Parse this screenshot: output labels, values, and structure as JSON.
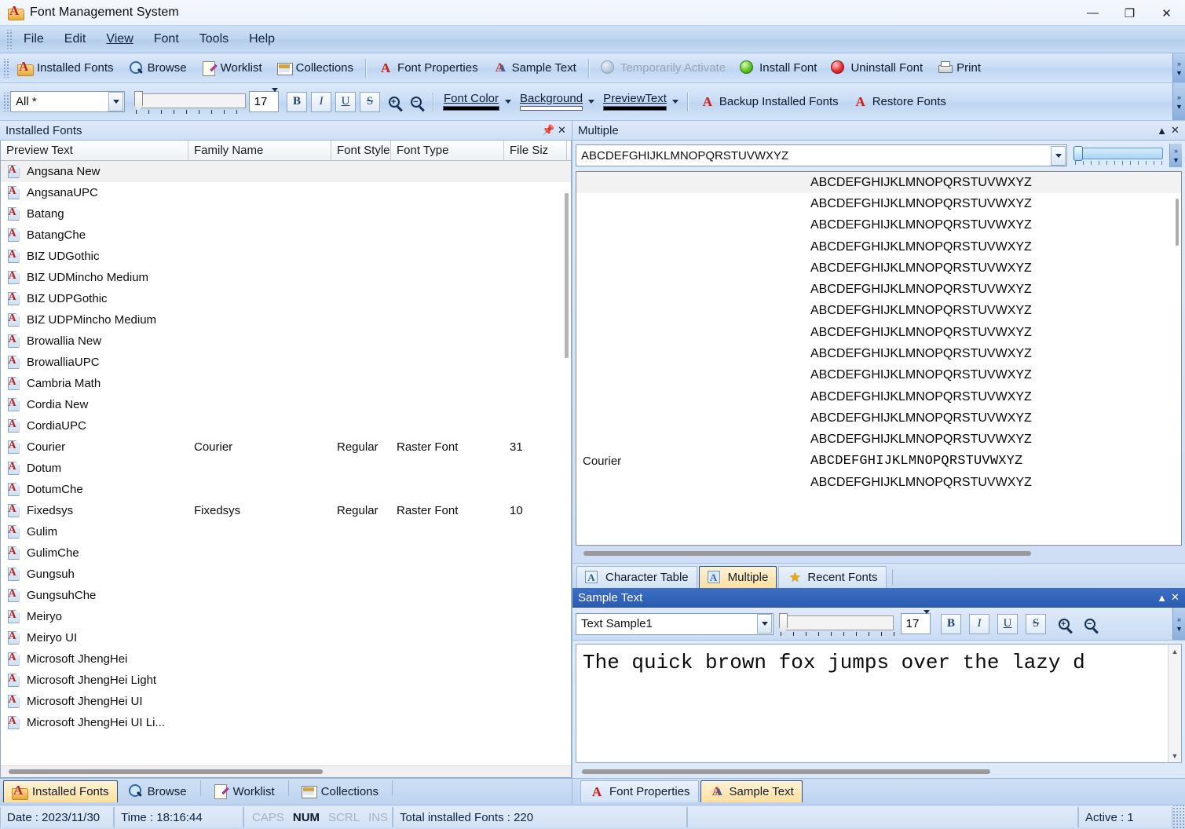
{
  "window": {
    "title": "Font Management System",
    "icon": "app-font-icon",
    "minimize": "—",
    "maximize": "❐",
    "close": "✕"
  },
  "menu": [
    "File",
    "Edit",
    "View",
    "Font",
    "Tools",
    "Help"
  ],
  "toolbar_main": [
    {
      "label": "Installed Fonts",
      "icon": "folder-a-icon",
      "disabled": false
    },
    {
      "label": "Browse",
      "icon": "magnifier-icon",
      "disabled": false
    },
    {
      "label": "Worklist",
      "icon": "clipboard-pencil-icon",
      "disabled": false
    },
    {
      "label": "Collections",
      "icon": "grid-icon",
      "disabled": false
    },
    {
      "label": "Font Properties",
      "icon": "red-a-icon",
      "disabled": false
    },
    {
      "label": "Sample Text",
      "icon": "double-a-icon",
      "disabled": false
    },
    {
      "label": "Temporarily Activate",
      "icon": "gray-circle-icon",
      "disabled": true
    },
    {
      "label": "Install Font",
      "icon": "green-circle-icon",
      "disabled": false
    },
    {
      "label": "Uninstall Font",
      "icon": "red-circle-icon",
      "disabled": false
    },
    {
      "label": "Print",
      "icon": "printer-icon",
      "disabled": false
    }
  ],
  "toolbar_format": {
    "filter_value": "All *",
    "size_value": "17",
    "bold": "B",
    "italic": "I",
    "underline": "U",
    "strikethrough": "S",
    "zoom_in": "+",
    "zoom_out": "−",
    "font_color_label": "Font Color",
    "font_color_value": "#000000",
    "background_label": "Background",
    "background_value": "#ffffff",
    "preview_text_label": "PreviewText",
    "preview_text_value": "#000000",
    "backup_label": "Backup Installed Fonts",
    "restore_label": "Restore Fonts"
  },
  "installed_panel": {
    "title": "Installed Fonts",
    "pin": "▮",
    "close": "✕",
    "columns": [
      "Preview Text",
      "Family Name",
      "Font Style",
      "Font Type",
      "File Siz"
    ],
    "rows": [
      {
        "preview": "Angsana New",
        "family": "",
        "style": "",
        "type": "",
        "size": "",
        "selected": true
      },
      {
        "preview": "AngsanaUPC",
        "family": "",
        "style": "",
        "type": "",
        "size": ""
      },
      {
        "preview": "Batang",
        "family": "",
        "style": "",
        "type": "",
        "size": ""
      },
      {
        "preview": "BatangChe",
        "family": "",
        "style": "",
        "type": "",
        "size": ""
      },
      {
        "preview": "BIZ UDGothic",
        "family": "",
        "style": "",
        "type": "",
        "size": ""
      },
      {
        "preview": "BIZ UDMincho Medium",
        "family": "",
        "style": "",
        "type": "",
        "size": ""
      },
      {
        "preview": "BIZ UDPGothic",
        "family": "",
        "style": "",
        "type": "",
        "size": ""
      },
      {
        "preview": "BIZ UDPMincho Medium",
        "family": "",
        "style": "",
        "type": "",
        "size": ""
      },
      {
        "preview": "Browallia New",
        "family": "",
        "style": "",
        "type": "",
        "size": ""
      },
      {
        "preview": "BrowalliaUPC",
        "family": "",
        "style": "",
        "type": "",
        "size": ""
      },
      {
        "preview": "Cambria Math",
        "family": "",
        "style": "",
        "type": "",
        "size": ""
      },
      {
        "preview": "Cordia New",
        "family": "",
        "style": "",
        "type": "",
        "size": ""
      },
      {
        "preview": "CordiaUPC",
        "family": "",
        "style": "",
        "type": "",
        "size": ""
      },
      {
        "preview": "Courier",
        "family": "Courier",
        "style": "Regular",
        "type": "Raster Font",
        "size": "31"
      },
      {
        "preview": "Dotum",
        "family": "",
        "style": "",
        "type": "",
        "size": ""
      },
      {
        "preview": "DotumChe",
        "family": "",
        "style": "",
        "type": "",
        "size": ""
      },
      {
        "preview": "Fixedsys",
        "family": "Fixedsys",
        "style": "Regular",
        "type": "Raster Font",
        "size": "10"
      },
      {
        "preview": "Gulim",
        "family": "",
        "style": "",
        "type": "",
        "size": ""
      },
      {
        "preview": "GulimChe",
        "family": "",
        "style": "",
        "type": "",
        "size": ""
      },
      {
        "preview": "Gungsuh",
        "family": "",
        "style": "",
        "type": "",
        "size": ""
      },
      {
        "preview": "GungsuhChe",
        "family": "",
        "style": "",
        "type": "",
        "size": ""
      },
      {
        "preview": "Meiryo",
        "family": "",
        "style": "",
        "type": "",
        "size": ""
      },
      {
        "preview": "Meiryo UI",
        "family": "",
        "style": "",
        "type": "",
        "size": ""
      },
      {
        "preview": "Microsoft JhengHei",
        "family": "",
        "style": "",
        "type": "",
        "size": ""
      },
      {
        "preview": "Microsoft JhengHei Light",
        "family": "",
        "style": "",
        "type": "",
        "size": ""
      },
      {
        "preview": "Microsoft JhengHei UI",
        "family": "",
        "style": "",
        "type": "",
        "size": ""
      },
      {
        "preview": "Microsoft JhengHei UI Li...",
        "family": "",
        "style": "",
        "type": "",
        "size": ""
      }
    ]
  },
  "multiple_panel": {
    "title": "Multiple",
    "collapse": "▲",
    "close": "✕",
    "sample_value": "ABCDEFGHIJKLMNOPQRSTUVWXYZ",
    "rows": [
      {
        "name": "",
        "text": "ABCDEFGHIJKLMNOPQRSTUVWXYZ",
        "mono": false,
        "selected": true
      },
      {
        "name": "",
        "text": "ABCDEFGHIJKLMNOPQRSTUVWXYZ",
        "mono": false
      },
      {
        "name": "",
        "text": "ABCDEFGHIJKLMNOPQRSTUVWXYZ",
        "mono": false
      },
      {
        "name": "",
        "text": "ABCDEFGHIJKLMNOPQRSTUVWXYZ",
        "mono": false
      },
      {
        "name": "",
        "text": "ABCDEFGHIJKLMNOPQRSTUVWXYZ",
        "mono": false
      },
      {
        "name": "",
        "text": "ABCDEFGHIJKLMNOPQRSTUVWXYZ",
        "mono": false
      },
      {
        "name": "",
        "text": "ABCDEFGHIJKLMNOPQRSTUVWXYZ",
        "mono": false
      },
      {
        "name": "",
        "text": "ABCDEFGHIJKLMNOPQRSTUVWXYZ",
        "mono": false
      },
      {
        "name": "",
        "text": "ABCDEFGHIJKLMNOPQRSTUVWXYZ",
        "mono": false
      },
      {
        "name": "",
        "text": "ABCDEFGHIJKLMNOPQRSTUVWXYZ",
        "mono": false
      },
      {
        "name": "",
        "text": "ABCDEFGHIJKLMNOPQRSTUVWXYZ",
        "mono": false
      },
      {
        "name": "",
        "text": "ABCDEFGHIJKLMNOPQRSTUVWXYZ",
        "mono": false
      },
      {
        "name": "",
        "text": "ABCDEFGHIJKLMNOPQRSTUVWXYZ",
        "mono": false
      },
      {
        "name": "Courier",
        "text": "ABCDEFGHIJKLMNOPQRSTUVWXYZ",
        "mono": true
      },
      {
        "name": "",
        "text": "ABCDEFGHIJKLMNOPQRSTUVWXYZ",
        "mono": false
      }
    ]
  },
  "preview_tabs": [
    {
      "label": "Character Table",
      "icon": "char-table-icon",
      "active": false
    },
    {
      "label": "Multiple",
      "icon": "multiple-icon",
      "active": true
    },
    {
      "label": "Recent Fonts",
      "icon": "star-icon",
      "active": false
    }
  ],
  "sample_panel": {
    "title": "Sample Text",
    "collapse": "▲",
    "close": "✕",
    "preset_value": "Text Sample1",
    "size_value": "17",
    "bold": "B",
    "italic": "I",
    "underline": "U",
    "strikethrough": "S",
    "content": "The quick brown fox jumps over the lazy d"
  },
  "bottom_tabs_left": [
    {
      "label": "Installed Fonts",
      "icon": "folder-a-icon",
      "active": true
    },
    {
      "label": "Browse",
      "icon": "magnifier-icon",
      "active": false
    },
    {
      "label": "Worklist",
      "icon": "clipboard-pencil-icon",
      "active": false
    },
    {
      "label": "Collections",
      "icon": "grid-icon",
      "active": false
    }
  ],
  "bottom_tabs_right": [
    {
      "label": "Font Properties",
      "icon": "red-a-icon",
      "active": false
    },
    {
      "label": "Sample Text",
      "icon": "double-a-icon",
      "active": true
    }
  ],
  "status": {
    "date": "Date : 2023/11/30",
    "time": "Time : 18:16:44",
    "indicators": [
      {
        "label": "CAPS",
        "on": false
      },
      {
        "label": "NUM",
        "on": true
      },
      {
        "label": "SCRL",
        "on": false
      },
      {
        "label": "INS",
        "on": false
      }
    ],
    "total": "Total installed Fonts : 220",
    "active": "Active : 1"
  }
}
